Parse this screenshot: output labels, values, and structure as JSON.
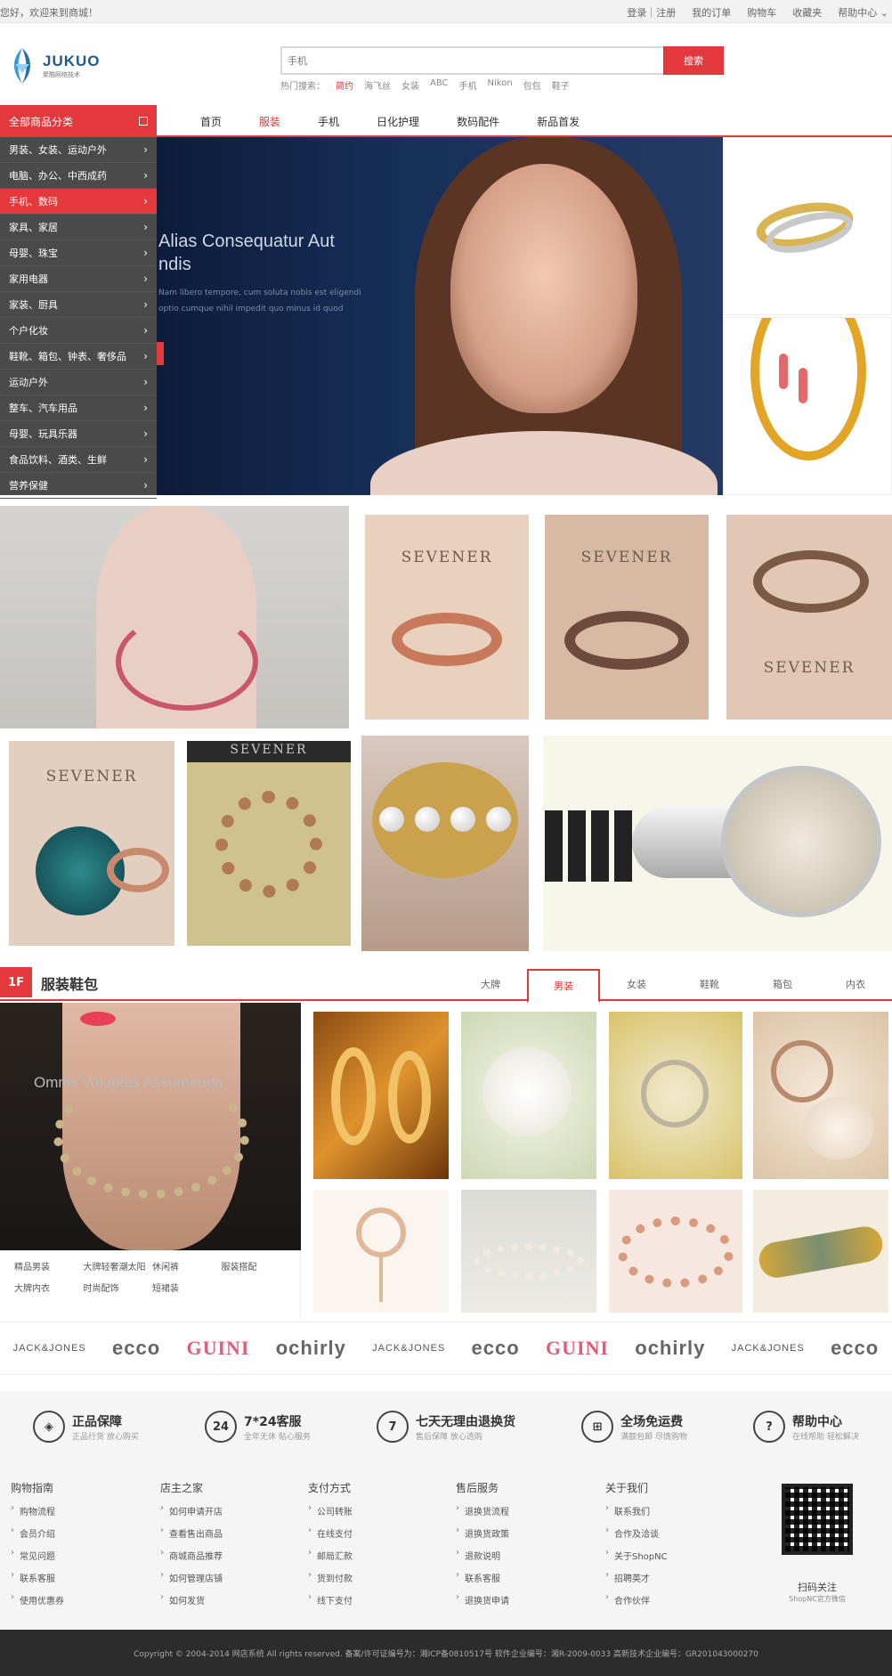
{
  "topbar": {
    "welcome": "您好，欢迎来到商城！",
    "links": [
      "登录｜注册",
      "我的订单",
      "购物车",
      "收藏夹",
      "帮助中心"
    ]
  },
  "logo": {
    "brand": "JUKUO",
    "sub": "聚酷网络技术"
  },
  "search": {
    "placeholder": "手机",
    "button": "搜索",
    "hot_label": "热门搜索：",
    "hot": [
      "简约",
      "海飞丝",
      "女装",
      "ABC",
      "手机",
      "Nikon",
      "包包",
      "鞋子"
    ]
  },
  "nav": {
    "all_categories": "全部商品分类",
    "links": [
      "首页",
      "服装",
      "手机",
      "日化护理",
      "数码配件",
      "新品首发"
    ]
  },
  "categories": [
    "男装、女装、运动户外",
    "电脑、办公、中西成药",
    "手机、数码",
    "家具、家居",
    "母婴、珠宝",
    "家用电器",
    "家装、厨具",
    "个户化妆",
    "鞋靴、箱包、钟表、奢侈品",
    "运动户外",
    "整车、汽车用品",
    "母婴、玩具乐器",
    "食品饮料、酒类、生鲜",
    "营养保健"
  ],
  "banner": {
    "headline_1": "Alias Consequatur Aut",
    "headline_2": "ndis",
    "desc_1": "Nam libero tempore, cum soluta nobis est eligendi",
    "desc_2": "optio cumque nihil impedit quo minus id quod"
  },
  "tiles": {
    "sevener": "SEVENER"
  },
  "floor": {
    "number": "1F",
    "title": "服装鞋包",
    "tabs": [
      "大牌",
      "男装",
      "女装",
      "鞋靴",
      "箱包",
      "内衣"
    ],
    "banner_caption": "Omnis Voluptas Assumenda",
    "links": [
      "精品男装",
      "大牌轻奢潮太阳",
      "休闲裤",
      "服装搭配",
      "大牌内衣",
      "时尚配饰",
      "短裙装"
    ]
  },
  "brands": [
    "JACK&JONES",
    "ecco",
    "GUINI",
    "ochirly",
    "JACK&JONES",
    "ecco",
    "GUINI",
    "ochirly",
    "JACK&JONES",
    "ecco"
  ],
  "services": [
    {
      "icon": "shield-icon",
      "glyph": "◈",
      "title": "正品保障",
      "sub": "正品行货 放心购买"
    },
    {
      "icon": "clock-24-icon",
      "glyph": "24",
      "title": "7*24客服",
      "sub": "全年无休 贴心服务"
    },
    {
      "icon": "return-7-icon",
      "glyph": "7",
      "title": "七天无理由退换货",
      "sub": "售后保障 放心选购"
    },
    {
      "icon": "gift-icon",
      "glyph": "⊞",
      "title": "全场免运费",
      "sub": "满额包邮 尽情购物"
    },
    {
      "icon": "help-icon",
      "glyph": "?",
      "title": "帮助中心",
      "sub": "在线帮助 轻松解决"
    }
  ],
  "footer": {
    "columns": [
      {
        "title": "购物指南",
        "links": [
          "购物流程",
          "会员介绍",
          "常见问题",
          "联系客服",
          "使用优惠券"
        ]
      },
      {
        "title": "店主之家",
        "links": [
          "如何申请开店",
          "查看售出商品",
          "商城商品推荐",
          "如何管理店铺",
          "如何发货"
        ]
      },
      {
        "title": "支付方式",
        "links": [
          "公司转账",
          "在线支付",
          "邮局汇款",
          "货到付款",
          "线下支付"
        ]
      },
      {
        "title": "售后服务",
        "links": [
          "退换货流程",
          "退换货政策",
          "退款说明",
          "联系客服",
          "退换货申请"
        ]
      },
      {
        "title": "关于我们",
        "links": [
          "联系我们",
          "合作及洽谈",
          "关于ShopNC",
          "招聘英才",
          "合作伙伴"
        ]
      }
    ],
    "qr_title": "扫码关注",
    "qr_sub": "ShopNC官方微信",
    "copyright": "Copyright © 2004-2014 网店系统 All rights reserved.  备案/许可证编号为：湘ICP备0810517号    软件企业编号：湘R-2009-0033  高新技术企业编号：GR201043000270"
  },
  "colors": {
    "accent": "#e4393c",
    "dark": "#2c2c2c"
  }
}
